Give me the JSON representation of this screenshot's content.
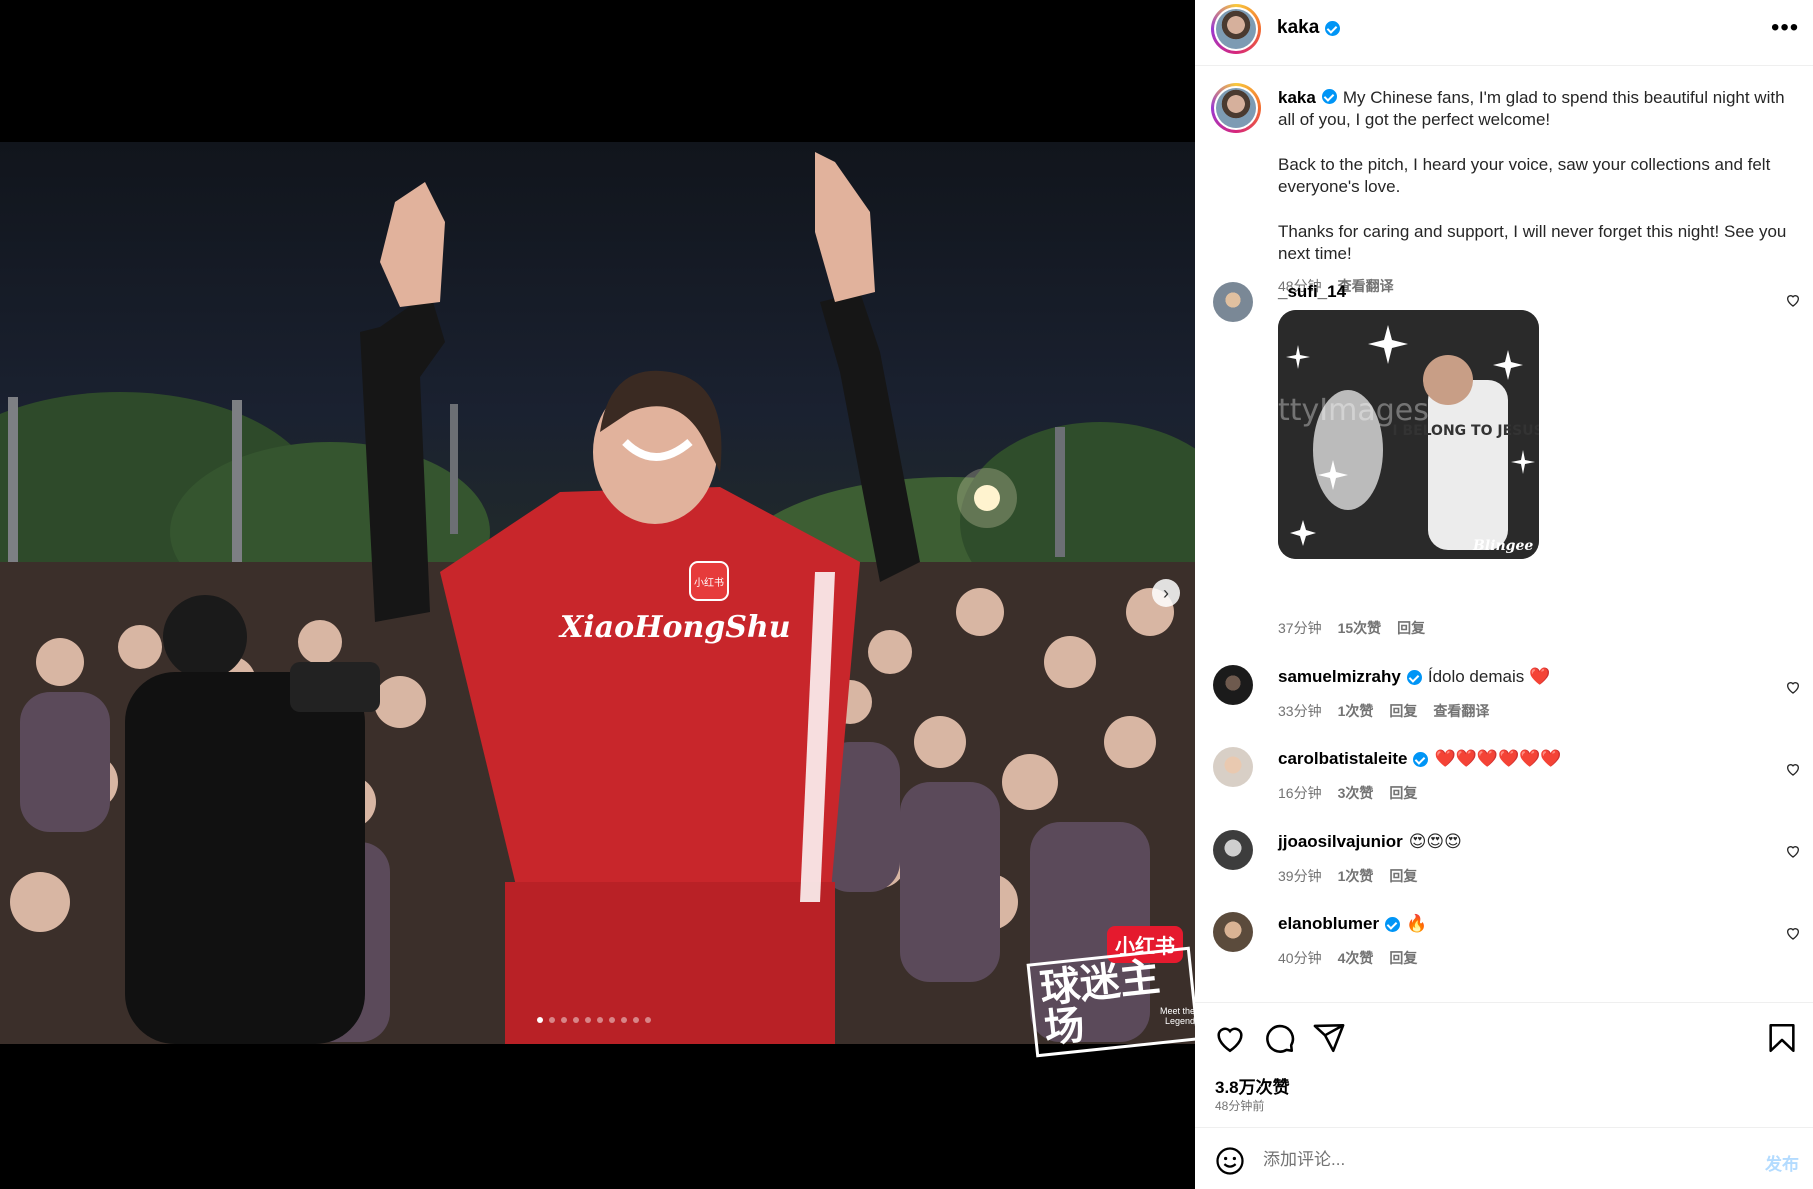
{
  "post": {
    "username": "kaka",
    "verified": true,
    "more_icon": "more-options-icon",
    "caption": [
      "My Chinese fans, I'm glad to spend this beautiful night with all of you, I got the perfect welcome!",
      "Back to the pitch, I heard your voice, saw your collections and felt everyone's love.",
      "Thanks for caring and support, I will never forget this night! See you next time!"
    ],
    "caption_time": "48分钟",
    "see_translation": "查看翻译"
  },
  "media": {
    "jersey_text": "XiaoHongShu",
    "badge_text": "小红书",
    "watermark_red": "小红书",
    "watermark_white": "球迷主场",
    "watermark_small": "Meet the Legend",
    "carousel_count": 10,
    "carousel_active": 0
  },
  "comments": [
    {
      "username": "_sufi_14",
      "verified": false,
      "text": "",
      "time": "37分钟",
      "likes": "15次赞",
      "reply": "回复",
      "has_gif": true,
      "gif_text": "I BELONG TO JESUS",
      "gif_brand": "Blingee",
      "gif_watermark": "ttyImages"
    },
    {
      "username": "samuelmizrahy",
      "verified": true,
      "text": "Ídolo demais ❤️",
      "time": "33分钟",
      "likes": "1次赞",
      "reply": "回复",
      "translate": "查看翻译"
    },
    {
      "username": "carolbatistaleite",
      "verified": true,
      "text": "❤️❤️❤️❤️❤️❤️",
      "time": "16分钟",
      "likes": "3次赞",
      "reply": "回复"
    },
    {
      "username": "jjoaosilvajunior",
      "verified": false,
      "text": "😍😍😍",
      "time": "39分钟",
      "likes": "1次赞",
      "reply": "回复"
    },
    {
      "username": "elanoblumer",
      "verified": true,
      "text": "🔥",
      "time": "40分钟",
      "likes": "4次赞",
      "reply": "回复"
    }
  ],
  "actions": {
    "like_icon": "heart-icon",
    "comment_icon": "comment-icon",
    "share_icon": "share-icon",
    "save_icon": "bookmark-icon",
    "likes_count": "3.8万次赞",
    "time_ago": "48分钟前"
  },
  "add_comment": {
    "emoji_icon": "emoji-icon",
    "placeholder": "添加评论...",
    "post_label": "发布"
  },
  "colors": {
    "verified": "#0095f6",
    "meta_gray": "#737373",
    "post_disabled": "#b3dbff",
    "heart_red": "#e0245e",
    "jersey_red": "#c8262b"
  }
}
